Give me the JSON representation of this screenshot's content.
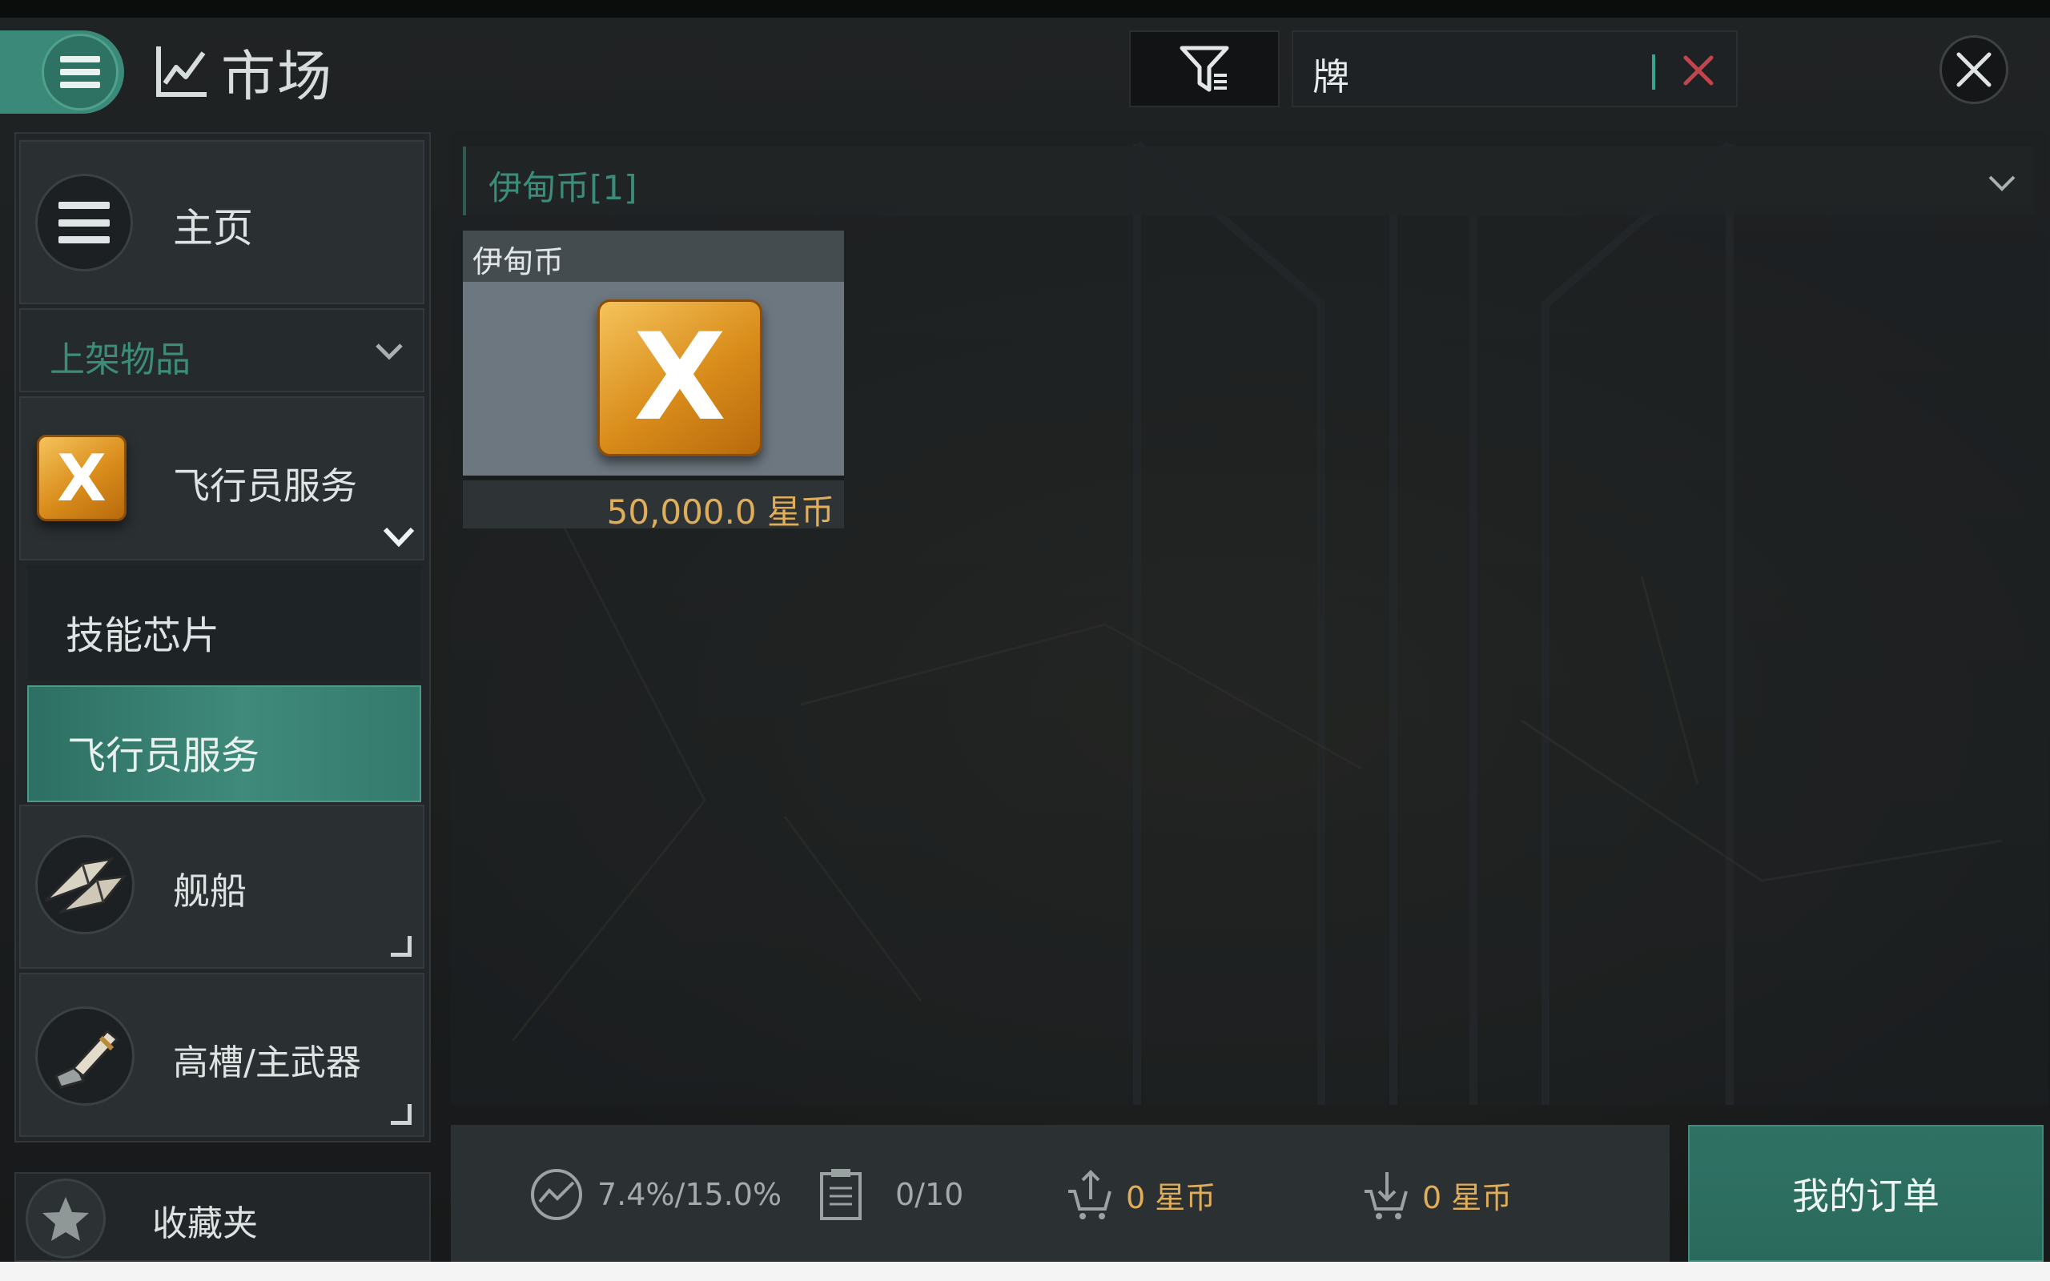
{
  "header": {
    "title": "市场",
    "search_value": "牌",
    "menu_icon": "hamburger-icon",
    "title_icon": "line-chart-icon",
    "filter_icon": "filter-icon",
    "clear_icon": "clear-x-icon",
    "close_icon": "close-icon"
  },
  "sidebar": {
    "home_label": "主页",
    "listed_items_label": "上架物品",
    "pilot_services_label": "飞行员服务",
    "skill_chips_label": "技能芯片",
    "pilot_services_sub_label": "飞行员服务",
    "ships_label": "舰船",
    "weapons_label": "高槽/主武器",
    "favorites_label": "收藏夹"
  },
  "content": {
    "category_header": "伊甸币[1]",
    "item": {
      "name": "伊甸币",
      "price": "50,000.0 星币",
      "icon_glyph": "X"
    }
  },
  "bottom_bar": {
    "tax_rate": "7.4%/15.0%",
    "orders_count": "0/10",
    "sell_value": "0 星币",
    "buy_value": "0 星币",
    "my_orders_label": "我的订单"
  },
  "colors": {
    "accent_teal": "#3b8a79",
    "price_gold": "#e0ad5b",
    "clear_red": "#c2454d"
  }
}
